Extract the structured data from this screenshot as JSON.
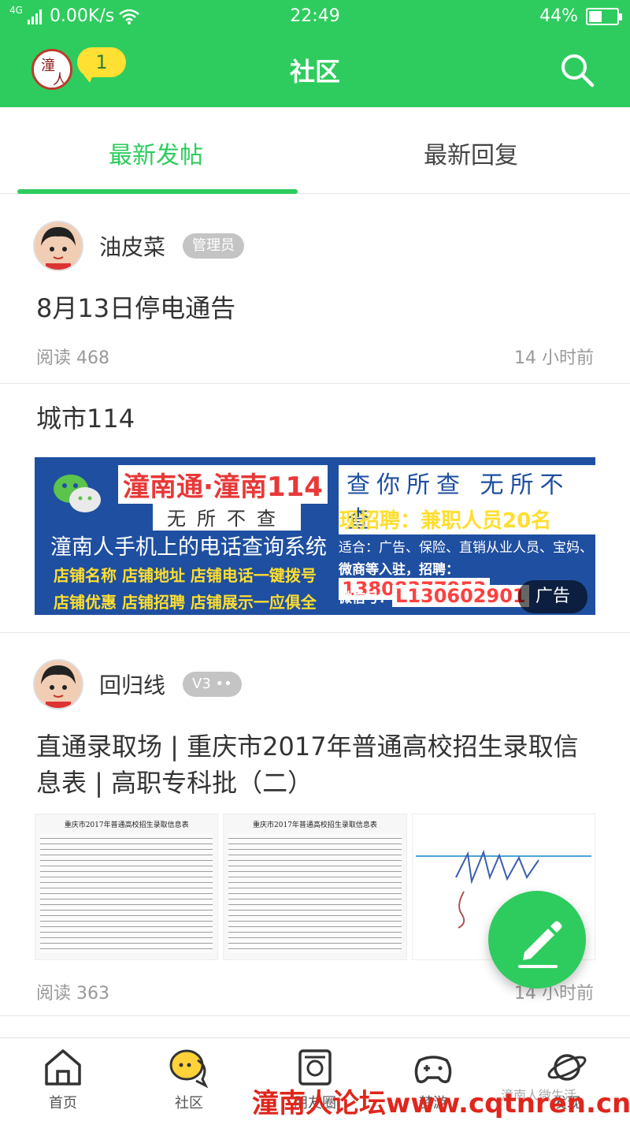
{
  "status_bar": {
    "network": "4G",
    "speed": "0.00K/s",
    "time": "22:49",
    "battery": "44%",
    "battery_level": 0.44
  },
  "header": {
    "title": "社区",
    "notification_count": "1"
  },
  "tabs": [
    {
      "label": "最新发帖",
      "active": true
    },
    {
      "label": "最新回复",
      "active": false
    }
  ],
  "posts": [
    {
      "user": "油皮菜",
      "badge": "管理员",
      "title": "8月13日停电通告",
      "reads": "阅读 468",
      "time": "14 小时前"
    },
    {
      "title": "城市114",
      "ad": {
        "brand": "潼南通·潼南114",
        "slogan": "无所不查",
        "desc": "潼南人手机上的电话查询系统",
        "features_1": "店铺名称  店铺地址  店铺电话一键拨号",
        "features_2": "店铺优惠  店铺招聘  店铺展示一应俱全",
        "right_title": "查你所查  无所不查",
        "hire": "现招聘：兼职人员20名",
        "detail": "适合：广告、保险、直销从业人员、宝妈、",
        "phone_label": "微商等入驻，招聘：",
        "phone": "13808377953",
        "wechat_label": "微信号：",
        "wechat": "L130602901",
        "tag": "广告"
      }
    },
    {
      "user": "回归线",
      "badge": "V3 ••",
      "title": "直通录取场 | 重庆市2017年普通高校招生录取信息表 | 高职专科批（二）",
      "thumb_caption_1": "重庆市2017年普通高校招生录取信息表",
      "thumb_caption_2": "重庆市2017年普通高校招生录取信息表",
      "reads": "阅读 363",
      "time": "14 小时前"
    }
  ],
  "bottom_nav": [
    {
      "label": "首页",
      "icon": "home-icon"
    },
    {
      "label": "社区",
      "icon": "chat-bubble-icon"
    },
    {
      "label": "朋友圈",
      "icon": "camera-frame-icon"
    },
    {
      "label": "梦游",
      "icon": "gamepad-icon"
    },
    {
      "label": "发现",
      "icon": "planet-icon"
    }
  ],
  "watermark": "潼南人论坛www.cqtnren.cn",
  "watermark_sub": "潼南人微生活",
  "colors": {
    "accent": "#2ecc5e",
    "ad_blue": "#1f4fa0",
    "badge_yellow": "#ffe033",
    "watermark_red": "#e0261c"
  }
}
